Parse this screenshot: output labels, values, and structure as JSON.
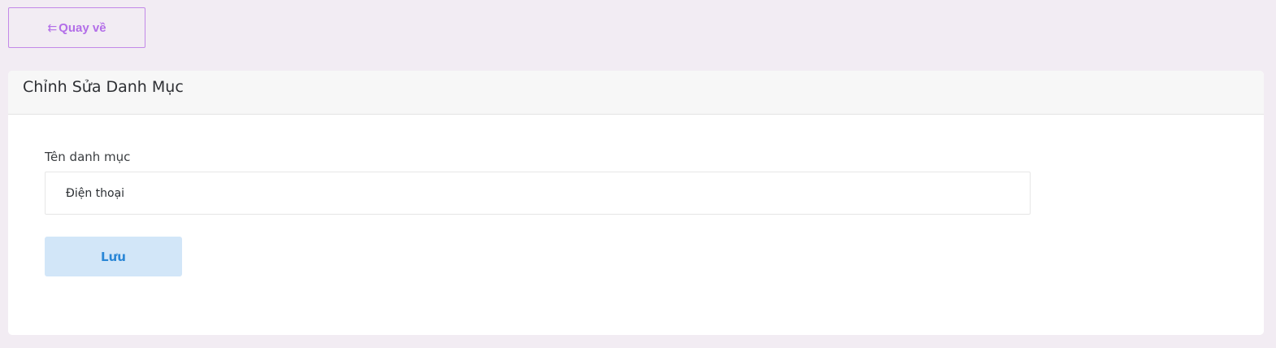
{
  "back_button": {
    "icon": "back-arrow-icon",
    "icon_glyph": "⇇",
    "label": "Quay về"
  },
  "card": {
    "title": "Chỉnh Sửa Danh Mục",
    "form": {
      "name_label": "Tên danh mục",
      "name_value": "Điện thoại",
      "save_label": "Lưu"
    }
  },
  "colors": {
    "page_background": "#f2ecf3",
    "back_button_accent": "#b36ee8",
    "save_button_background": "#d2e6f8",
    "save_button_text": "#2b87d6"
  }
}
